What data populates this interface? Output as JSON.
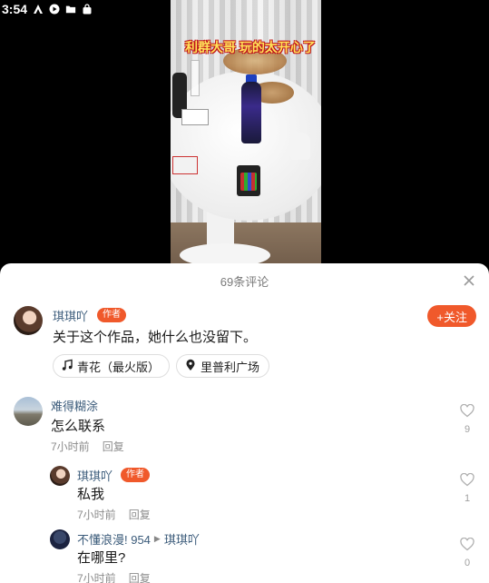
{
  "status_bar": {
    "time": "3:54"
  },
  "video": {
    "caption": "利群大哥 玩的太开心了"
  },
  "comments_panel": {
    "title": "69条评论",
    "author_post": {
      "username": "琪琪吖",
      "badge": "作者",
      "follow_label": "+关注",
      "text": "关于这个作品，她什么也没留下。",
      "music_chip": "青花（最火版）",
      "location_chip": "里普利广场"
    },
    "comments": [
      {
        "username": "难得糊涂",
        "text": "怎么联系",
        "time": "7小时前",
        "reply_label": "回复",
        "likes": "9"
      }
    ],
    "replies": [
      {
        "username": "琪琪吖",
        "badge": "作者",
        "text": "私我",
        "time": "7小时前",
        "reply_label": "回复",
        "likes": "1"
      },
      {
        "username": "不懂浪漫! 954",
        "reply_to": "琪琪吖",
        "text": "在哪里?",
        "time": "7小时前",
        "reply_label": "回复",
        "likes": "0"
      }
    ]
  },
  "colors": {
    "accent": "#f0592b",
    "username": "#3b5b7a",
    "meta": "#8c8c8c"
  }
}
